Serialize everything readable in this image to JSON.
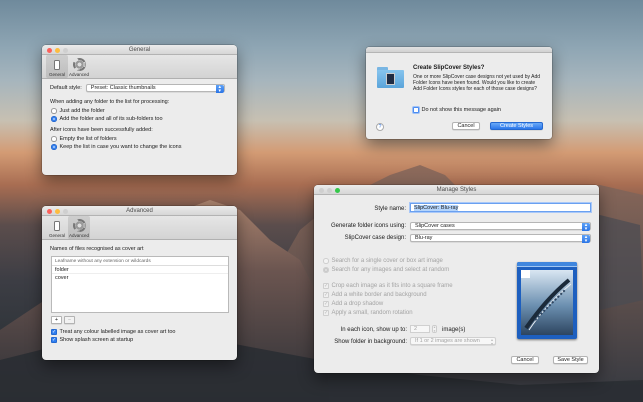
{
  "general": {
    "title": "General",
    "toolbar": [
      "General",
      "Advanced"
    ],
    "default_style_label": "Default style:",
    "default_style_value": "Preset: Classic thumbnails",
    "adding_heading": "When adding any folder to the list for processing:",
    "adding_options": [
      "Just add the folder",
      "Add the folder and all of its sub-folders too"
    ],
    "after_heading": "After icons have been successfully added:",
    "after_options": [
      "Empty the list of folders",
      "Keep the list in case you want to change the icons"
    ]
  },
  "advanced": {
    "title": "Advanced",
    "toolbar": [
      "General",
      "Advanced"
    ],
    "names_label": "Names of files recognised as cover art",
    "list_header": "Leafname without any extension or wildcards",
    "list_items": [
      "folder",
      "cover"
    ],
    "add_btn": "+",
    "remove_btn": "−",
    "treat_colour": "Treat any colour labelled image as cover art too",
    "show_splash": "Show splash screen at startup"
  },
  "dialog": {
    "title": "Create SlipCover Styles?",
    "body": "One or more SlipCover case designs not yet used by Add Folder Icons have been found. Would you like to create Add Folder Icons styles for each of those case designs?",
    "dont_show": "Do not show this message again",
    "help": "?",
    "cancel": "Cancel",
    "create": "Create Styles"
  },
  "manage": {
    "title": "Manage Styles",
    "style_name_label": "Style name:",
    "style_name_value": "SlipCover: Blu-ray",
    "generate_label": "Generate folder icons using:",
    "generate_value": "SlipCover cases",
    "case_label": "SlipCover case design:",
    "case_value": "Blu-ray",
    "radio_options": [
      "Search for a single cover or box art image",
      "Search for any images and select at random"
    ],
    "check_options": [
      "Crop each image as it fits into a square frame",
      "Add a white border and background",
      "Add a drop shadow",
      "Apply a small, random rotation"
    ],
    "each_icon_label": "In each icon, show up to:",
    "each_icon_value": "2",
    "each_icon_suffix": "image(s)",
    "show_folder_label": "Show folder in background:",
    "show_folder_value": "If 1 or 2 images are shown",
    "cancel": "Cancel",
    "save": "Save Style"
  }
}
